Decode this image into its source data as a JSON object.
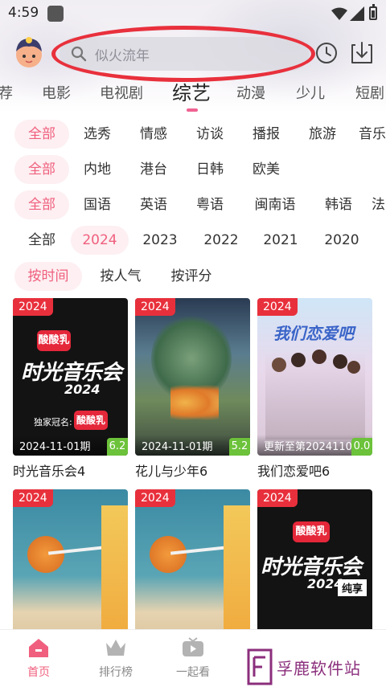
{
  "status_bar": {
    "time": "4:59"
  },
  "search": {
    "placeholder": "似火流年"
  },
  "category_tabs": [
    {
      "label": "荐"
    },
    {
      "label": "电影"
    },
    {
      "label": "电视剧"
    },
    {
      "label": "综艺",
      "active": true
    },
    {
      "label": "动漫"
    },
    {
      "label": "少儿"
    },
    {
      "label": "短剧"
    }
  ],
  "filters": {
    "type": [
      "全部",
      "选秀",
      "情感",
      "访谈",
      "播报",
      "旅游",
      "音乐"
    ],
    "region": [
      "全部",
      "内地",
      "港台",
      "日韩",
      "欧美"
    ],
    "language": [
      "全部",
      "国语",
      "英语",
      "粤语",
      "闽南语",
      "韩语",
      "法"
    ],
    "year": [
      "全部",
      "2024",
      "2023",
      "2022",
      "2021",
      "2020"
    ],
    "sort": [
      "按时间",
      "按人气",
      "按评分"
    ]
  },
  "cards": [
    {
      "year": "2024",
      "episode": "2024-11-01期",
      "score": "6.2",
      "title": "时光音乐会4",
      "poster_text": "时光音乐会",
      "poster_year": "2024",
      "poster_brand": "酸酸乳",
      "poster_sub": "独家冠名:"
    },
    {
      "year": "2024",
      "episode": "2024-11-01期",
      "score": "5.2",
      "title": "花儿与少年6",
      "poster_text": ""
    },
    {
      "year": "2024",
      "episode": "更新至第20241104期",
      "score": "0.0",
      "title": "我们恋爱吧6",
      "poster_text": "我们恋爱吧"
    },
    {
      "year": "2024",
      "title": ""
    },
    {
      "year": "2024",
      "title": ""
    },
    {
      "year": "2024",
      "title": "",
      "poster_text": "时光音乐会",
      "poster_year": "2024",
      "poster_tag": "纯享",
      "poster_brand": "酸酸乳"
    }
  ],
  "bottom_nav": [
    {
      "label": "首页",
      "active": true
    },
    {
      "label": "排行榜"
    },
    {
      "label": "一起看"
    }
  ],
  "watermark": {
    "text": "孚鹿软件站"
  },
  "colors": {
    "accent": "#f0607e",
    "badge": "#e8303c",
    "score": "#6cc23a"
  }
}
